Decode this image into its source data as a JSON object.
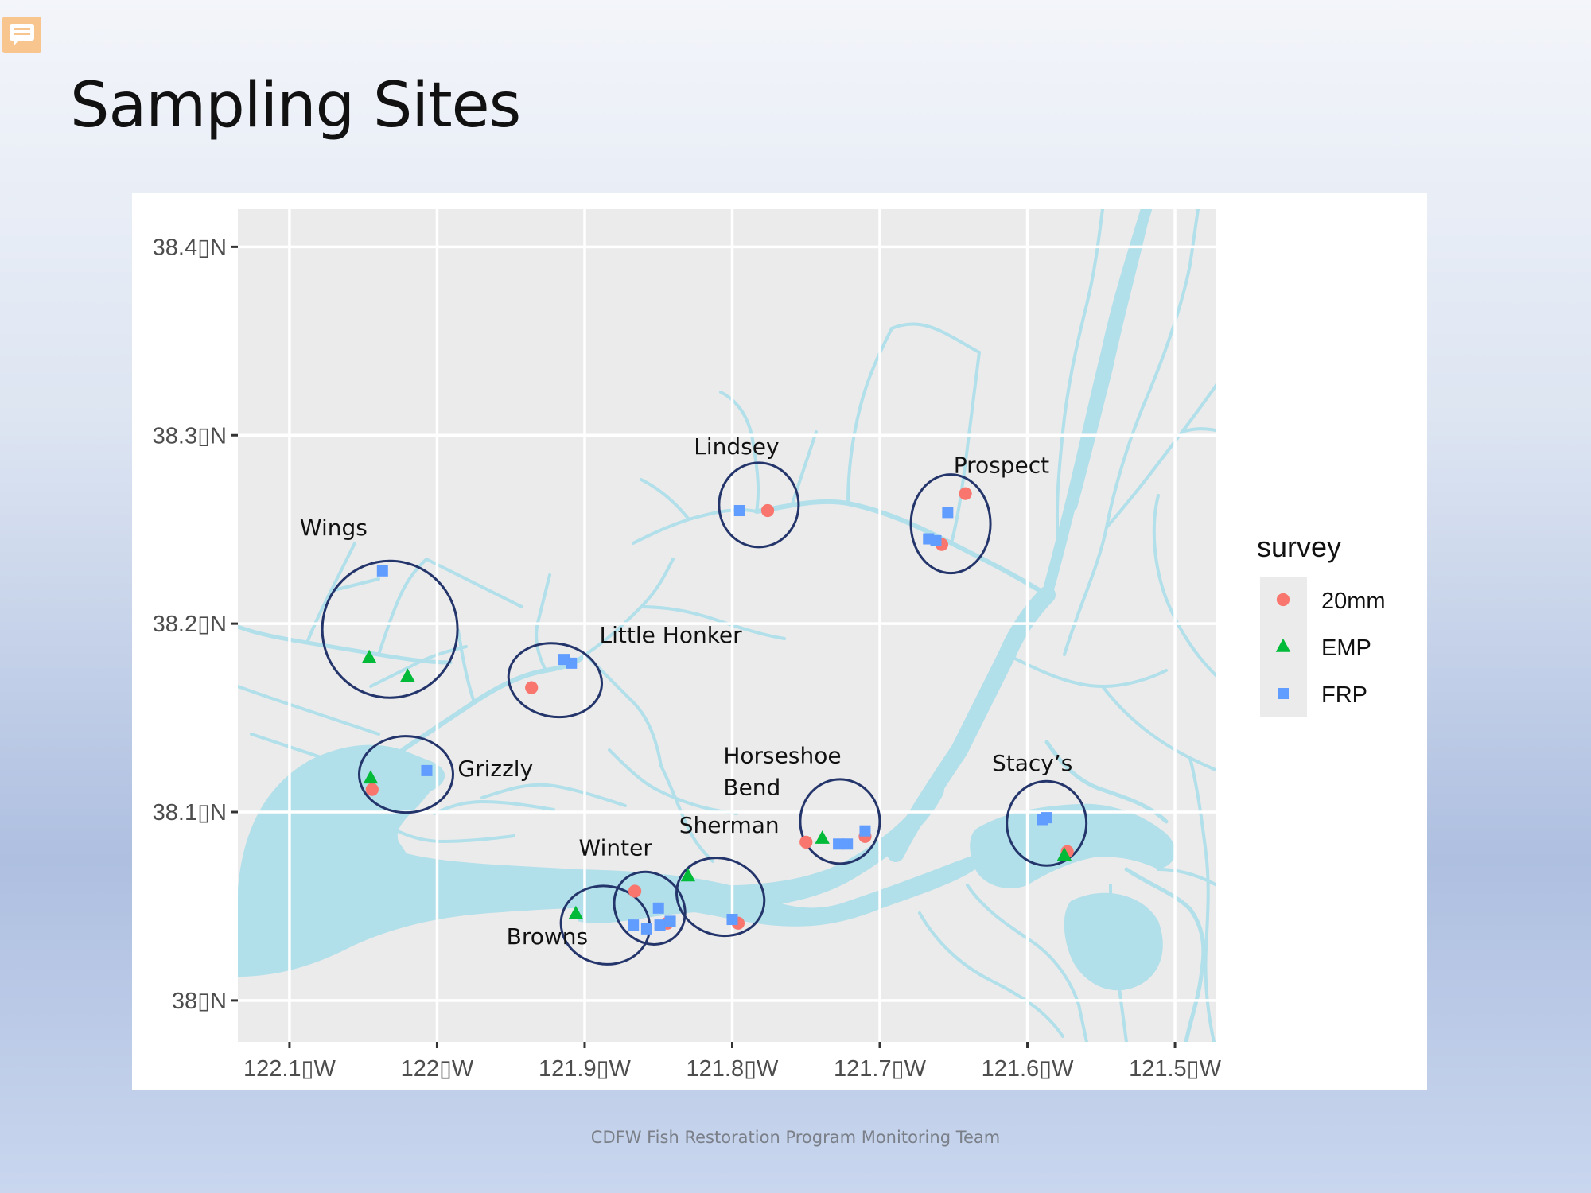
{
  "slide": {
    "title": "Sampling Sites",
    "footer": "CDFW Fish Restoration Program Monitoring Team"
  },
  "chart_data": {
    "type": "scatter",
    "xlim": [
      -122.135,
      -121.472
    ],
    "ylim": [
      37.978,
      38.42
    ],
    "x_ticks": [
      {
        "value": -122.1,
        "label": "122.1▯W"
      },
      {
        "value": -122.0,
        "label": "122▯W"
      },
      {
        "value": -121.9,
        "label": "121.9▯W"
      },
      {
        "value": -121.8,
        "label": "121.8▯W"
      },
      {
        "value": -121.7,
        "label": "121.7▯W"
      },
      {
        "value": -121.6,
        "label": "121.6▯W"
      },
      {
        "value": -121.5,
        "label": "121.5▯W"
      }
    ],
    "y_ticks": [
      {
        "value": 38.4,
        "label": "38.4▯N"
      },
      {
        "value": 38.3,
        "label": "38.3▯N"
      },
      {
        "value": 38.2,
        "label": "38.2▯N"
      },
      {
        "value": 38.1,
        "label": "38.1▯N"
      },
      {
        "value": 38.0,
        "label": "38▯N"
      }
    ],
    "grid": true,
    "legend": {
      "title": "survey",
      "placement": "right"
    },
    "colors": {
      "panel": "#ebebeb",
      "water": "#b1dfea",
      "circle": "#24356b",
      "grid": "#ffffff"
    },
    "series": [
      {
        "name": "20mm",
        "shape": "circle",
        "color": "#f8766d",
        "points": [
          [
            -122.044,
            38.112
          ],
          [
            -121.936,
            38.166
          ],
          [
            -121.866,
            38.058
          ],
          [
            -121.844,
            38.041
          ],
          [
            -121.796,
            38.041
          ],
          [
            -121.776,
            38.26
          ],
          [
            -121.75,
            38.084
          ],
          [
            -121.71,
            38.087
          ],
          [
            -121.658,
            38.242
          ],
          [
            -121.642,
            38.269
          ],
          [
            -121.573,
            38.079
          ]
        ]
      },
      {
        "name": "EMP",
        "shape": "triangle",
        "color": "#00ba38",
        "points": [
          [
            -122.046,
            38.182
          ],
          [
            -122.045,
            38.118
          ],
          [
            -122.02,
            38.172
          ],
          [
            -121.906,
            38.046
          ],
          [
            -121.83,
            38.066
          ],
          [
            -121.739,
            38.086
          ],
          [
            -121.575,
            38.077
          ]
        ]
      },
      {
        "name": "FRP",
        "shape": "square",
        "color": "#619cff",
        "points": [
          [
            -122.037,
            38.228
          ],
          [
            -122.007,
            38.122
          ],
          [
            -121.914,
            38.181
          ],
          [
            -121.909,
            38.179
          ],
          [
            -121.867,
            38.04
          ],
          [
            -121.858,
            38.038
          ],
          [
            -121.85,
            38.049
          ],
          [
            -121.849,
            38.04
          ],
          [
            -121.842,
            38.042
          ],
          [
            -121.8,
            38.043
          ],
          [
            -121.795,
            38.26
          ],
          [
            -121.728,
            38.083
          ],
          [
            -121.722,
            38.083
          ],
          [
            -121.71,
            38.09
          ],
          [
            -121.667,
            38.245
          ],
          [
            -121.662,
            38.244
          ],
          [
            -121.654,
            38.259
          ],
          [
            -121.59,
            38.096
          ],
          [
            -121.587,
            38.097
          ]
        ]
      }
    ],
    "annotations": [
      {
        "text": "Wings",
        "lon": -122.093,
        "lat": 38.247
      },
      {
        "text": "Little Honker",
        "lon": -121.89,
        "lat": 38.19
      },
      {
        "text": "Grizzly",
        "lon": -121.986,
        "lat": 38.119
      },
      {
        "text": "Lindsey",
        "lon": -121.826,
        "lat": 38.29
      },
      {
        "text": "Prospect",
        "lon": -121.65,
        "lat": 38.28
      },
      {
        "text": "Horseshoe",
        "lon": -121.806,
        "lat": 38.126
      },
      {
        "text": "Bend",
        "lon": -121.806,
        "lat": 38.109
      },
      {
        "text": "Sherman",
        "lon": -121.836,
        "lat": 38.089
      },
      {
        "text": "Winter",
        "lon": -121.904,
        "lat": 38.077
      },
      {
        "text": "Browns",
        "lon": -121.953,
        "lat": 38.03
      },
      {
        "text": "Stacy’s",
        "lon": -121.624,
        "lat": 38.122
      }
    ],
    "site_circles": [
      {
        "site": "Wings",
        "lon": -122.032,
        "lat": 38.197
      },
      {
        "site": "Little Honker",
        "lon": -121.92,
        "lat": 38.17
      },
      {
        "site": "Grizzly",
        "lon": -122.021,
        "lat": 38.12
      },
      {
        "site": "Lindsey",
        "lon": -121.782,
        "lat": 38.263
      },
      {
        "site": "Prospect",
        "lon": -121.652,
        "lat": 38.253
      },
      {
        "site": "Horseshoe Bend",
        "lon": -121.727,
        "lat": 38.095
      },
      {
        "site": "Stacy’s",
        "lon": -121.587,
        "lat": 38.094
      },
      {
        "site": "Sherman",
        "lon": -121.808,
        "lat": 38.055
      },
      {
        "site": "Winter",
        "lon": -121.856,
        "lat": 38.049
      },
      {
        "site": "Browns",
        "lon": -121.886,
        "lat": 38.04
      }
    ]
  }
}
